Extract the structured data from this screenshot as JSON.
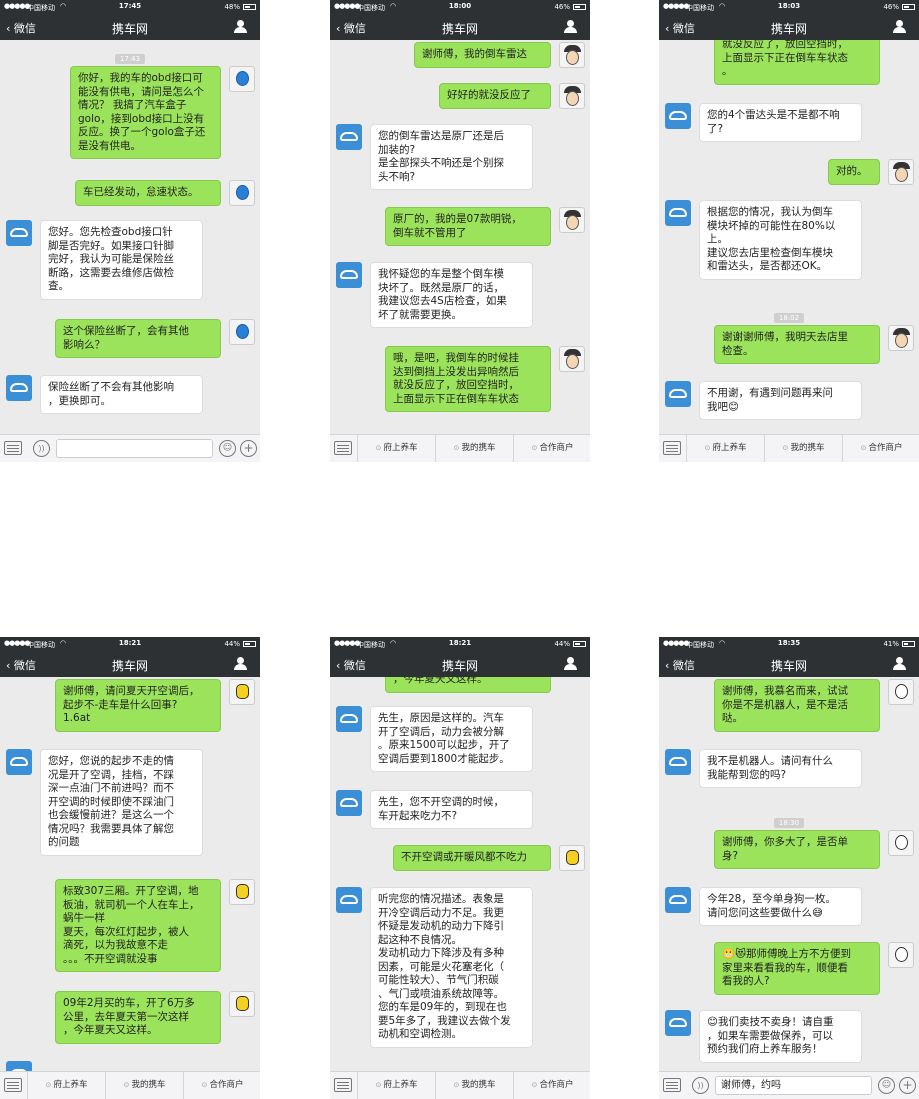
{
  "screens": [
    {
      "status": {
        "signal": "●●●●●",
        "carrier": "中国移动",
        "time": "17:45",
        "battery": "48%"
      },
      "nav": {
        "back": "微信",
        "title": "携车网"
      },
      "timestamps": [
        "17:43"
      ],
      "messages": [
        {
          "text": "你好，我的车的obd接口可\n能没有供电，请问是怎么个\n情况？ 我搞了汽车盒子\ngolo，接到obd接口上没有\n反应。换了一个golo盒子还\n是没有供电。"
        },
        {
          "text": "车已经发动，怠速状态。"
        },
        {
          "text": "您好。您先检查obd接口针\n脚是否完好。如果接口针脚\n完好，我认为可能是保险丝\n断路，这需要去维修店做检\n查。"
        },
        {
          "text": "这个保险丝断了，会有其他\n影响么？"
        },
        {
          "text": "保险丝断了不会有其他影响\n，更换即可。"
        }
      ],
      "input": {
        "value": ""
      }
    },
    {
      "status": {
        "signal": "●●●●●",
        "carrier": "中国移动",
        "time": "18:00",
        "battery": "46%"
      },
      "nav": {
        "back": "微信",
        "title": "携车网"
      },
      "timestamps": [],
      "messages": [
        {
          "text": "谢师傅，我的倒车雷达"
        },
        {
          "text": "好好的就没反应了"
        },
        {
          "text": "您的倒车雷达是原厂还是后\n加装的?\n是全部探头不响还是个别探\n头不响?"
        },
        {
          "text": "原厂的，我的是07款明锐，\n倒车就不管用了"
        },
        {
          "text": "我怀疑您的车是整个倒车模\n块坏了。既然是原厂的话，\n我建议您去4S店检查，如果\n坏了就需要更换。"
        },
        {
          "text": "哦，是吧，我倒车的时候挂\n达到倒挡上没发出异响然后\n就没反应了，放回空挡时，\n上面显示下正在倒车车状态"
        }
      ],
      "menu": [
        "府上养车",
        "我的携车",
        "合作商户"
      ]
    },
    {
      "status": {
        "signal": "●●●●●",
        "carrier": "中国移动",
        "time": "18:03",
        "battery": "46%"
      },
      "nav": {
        "back": "微信",
        "title": "携车网"
      },
      "timestamps": [
        "18:02"
      ],
      "messages": [
        {
          "text": "就没反应了，放回空挡时，\n上面显示下正在倒车车状态\n。"
        },
        {
          "text": "您的4个雷达头是不是都不响\n了?"
        },
        {
          "text": "对的。"
        },
        {
          "text": "根据您的情况，我认为倒车\n模块坏掉的可能性在80%以\n上。\n建议您去店里检查倒车模块\n和雷达头，是否都还OK。"
        },
        {
          "text": "谢谢谢师傅，我明天去店里\n检查。"
        },
        {
          "text": "不用谢，有遇到问题再来问\n我吧😊"
        }
      ],
      "menu": [
        "府上养车",
        "我的携车",
        "合作商户"
      ]
    },
    {
      "status": {
        "signal": "●●●●●",
        "carrier": "中国移动",
        "time": "18:21",
        "battery": "44%"
      },
      "nav": {
        "back": "微信",
        "title": "携车网"
      },
      "timestamps": [],
      "messages": [
        {
          "text": "谢师傅，请问夏天开空调后，\n起步不-走车是什么回事?\n1.6at"
        },
        {
          "text": "您好，您说的起步不走的情\n况是开了空调，挂档，不踩\n深一点油门不前进吗？而不\n开空调的时候即使不踩油门\n也会缓慢前进？是这么一个\n情况吗？我需要具体了解您\n的问题"
        },
        {
          "text": "标致307三厢。开了空调，地\n板油，就司机一个人在车上，\n蜗牛一样\n夏天，每次红灯起步，被人\n滴死，以为我故意不走\n。。。不开空调就没事"
        },
        {
          "text": "09年2月买的车，开了6万多\n公里，去年夏天第一次这样\n，今年夏天又这样。"
        }
      ],
      "menu": [
        "府上养车",
        "我的携车",
        "合作商户"
      ]
    },
    {
      "status": {
        "signal": "●●●●●",
        "carrier": "中国移动",
        "time": "18:21",
        "battery": "44%"
      },
      "nav": {
        "back": "微信",
        "title": "携车网"
      },
      "timestamps": [],
      "messages": [
        {
          "text": "，今年夏天又这样。"
        },
        {
          "text": "先生，原因是这样的。汽车\n开了空调后，动力会被分解\n。原来1500可以起步，开了\n空调后要到1800才能起步。"
        },
        {
          "text": "先生，您不开空调的时候，\n车开起来吃力不?"
        },
        {
          "text": "不开空调或开暖风都不吃力"
        },
        {
          "text": "听完您的情况描述。表象是\n开冷空调后动力不足。我更\n怀疑是发动机的动力下降引\n起这种不良情况。\n发动机动力下降涉及有多种\n因素，可能是火花塞老化（\n可能性较大）、节气门积碳\n、气门或喷油系统故障等。\n您的车是09年的，到现在也\n要5年多了，我建议去做个发\n动机和空调检测。"
        }
      ],
      "menu": [
        "府上养车",
        "我的携车",
        "合作商户"
      ]
    },
    {
      "status": {
        "signal": "●●●●●",
        "carrier": "中国移动",
        "time": "18:35",
        "battery": "41%"
      },
      "nav": {
        "back": "微信",
        "title": "携车网"
      },
      "timestamps": [
        "18:30"
      ],
      "messages": [
        {
          "text": "谢师傅，我慕名而来，试试\n你是不是机器人，是不是活\n哒。"
        },
        {
          "text": "我不是机器人。请问有什么\n我能帮到您的吗?"
        },
        {
          "text": "谢师傅，你多大了，是否单\n身?"
        },
        {
          "text": "今年28，至今单身狗一枚。\n请问您问这些要做什么😅"
        },
        {
          "text": "😬😻那师傅晚上方不方便到\n家里来看看我的车，顺便看\n看我的人?"
        },
        {
          "text": "😊我们卖技不卖身！请自重\n，如果车需要做保养，可以\n预约我们府上养车服务！"
        }
      ],
      "input": {
        "value": "谢师傅，约吗"
      }
    }
  ]
}
